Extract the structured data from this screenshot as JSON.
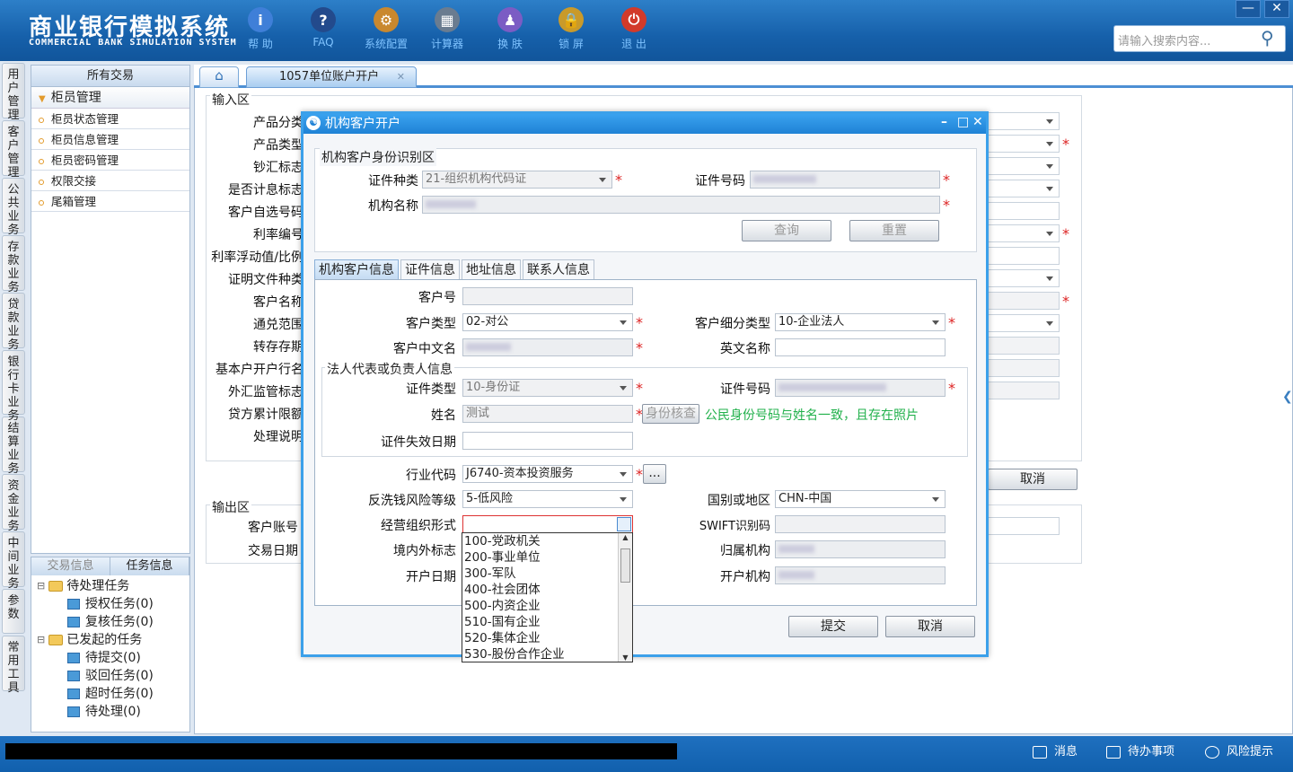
{
  "app": {
    "title_cn": "商业银行模拟系统",
    "title_en": "COMMERCIAL BANK SIMULATION SYSTEM"
  },
  "toolbar": [
    {
      "label": "帮 助",
      "icon": "info-icon",
      "glyph": "i",
      "color": "#3f7fd8"
    },
    {
      "label": "FAQ",
      "icon": "question-icon",
      "glyph": "?",
      "color": "#234a8c"
    },
    {
      "label": "系统配置",
      "icon": "toolbox-icon",
      "glyph": "⚙",
      "color": "#c9882e"
    },
    {
      "label": "计算器",
      "icon": "calculator-icon",
      "glyph": "▦",
      "color": "#6a7c90"
    },
    {
      "label": "换 肤",
      "icon": "shirt-icon",
      "glyph": "♟",
      "color": "#7b5cc4"
    },
    {
      "label": "锁 屏",
      "icon": "lock-icon",
      "glyph": "🔒",
      "color": "#c99a2a"
    },
    {
      "label": "退 出",
      "icon": "power-icon",
      "glyph": "⏻",
      "color": "#d23a2a"
    }
  ],
  "search": {
    "placeholder": "请输入搜索内容..."
  },
  "side_tabs": [
    "用户管理",
    "客户管理",
    "公共业务",
    "存款业务",
    "贷款业务",
    "银行卡业务",
    "结算业务",
    "资金业务",
    "中间业务",
    "参数",
    "常用工具"
  ],
  "nav": {
    "header": "所有交易",
    "group": "柜员管理",
    "items": [
      "柜员状态管理",
      "柜员信息管理",
      "柜员密码管理",
      "权限交接",
      "尾箱管理"
    ]
  },
  "tasks": {
    "tabs": [
      "交易信息",
      "任务信息"
    ],
    "pending_label": "待处理任务",
    "pending": [
      "授权任务(0)",
      "复核任务(0)"
    ],
    "initiated_label": "已发起的任务",
    "initiated": [
      "待提交(0)",
      "驳回任务(0)",
      "超时任务(0)",
      "待处理(0)"
    ]
  },
  "tabs": {
    "page": "1057单位账户开户"
  },
  "background": {
    "input_area": "输入区",
    "labels": [
      "产品分类",
      "产品类型",
      "钞汇标志",
      "是否计息标志",
      "客户自选号码",
      "利率编号",
      "利率浮动值/比例",
      "证明文件种类",
      "客户名称",
      "通兑范围",
      "转存存期",
      "基本户开户行名",
      "外汇监管标志",
      "贷方累计限额",
      "处理说明"
    ],
    "output_area": "输出区",
    "output_labels": [
      "客户账号",
      "交易日期"
    ],
    "cancel": "取消"
  },
  "dialog": {
    "title": "机构客户开户",
    "id_section": "机构客户身份识别区",
    "id_type_label": "证件种类",
    "id_type_value": "21-组织机构代码证",
    "id_no_label": "证件号码",
    "name_label": "机构名称",
    "query_btn": "查询",
    "reset_btn": "重置",
    "tabs": [
      "机构客户信息",
      "证件信息",
      "地址信息",
      "联系人信息"
    ],
    "cust_no_label": "客户号",
    "cust_type_label": "客户类型",
    "cust_type_value": "02-对公",
    "cust_sub_label": "客户细分类型",
    "cust_sub_value": "10-企业法人",
    "cn_name_label": "客户中文名",
    "en_name_label": "英文名称",
    "legal_section": "法人代表或负责人信息",
    "legal_id_type_label": "证件类型",
    "legal_id_type_value": "10-身份证",
    "legal_id_no_label": "证件号码",
    "legal_name_label": "姓名",
    "legal_name_value": "测试",
    "verify_btn": "身份核查",
    "verify_msg": "公民身份号码与姓名一致，且存在照片",
    "expire_label": "证件失效日期",
    "industry_label": "行业代码",
    "industry_value": "J6740-资本投资服务",
    "more_btn": "...",
    "aml_label": "反洗钱风险等级",
    "aml_value": "5-低风险",
    "country_label": "国别或地区",
    "country_value": "CHN-中国",
    "org_form_label": "经营组织形式",
    "swift_label": "SWIFT识别码",
    "domestic_label": "境内外标志",
    "belong_label": "归属机构",
    "open_date_label": "开户日期",
    "open_org_label": "开户机构",
    "submit_btn": "提交",
    "cancel_btn": "取消"
  },
  "dropdown": [
    "100-党政机关",
    "200-事业单位",
    "300-军队",
    "400-社会团体",
    "500-内资企业",
    "510-国有企业",
    "520-集体企业",
    "530-股份合作企业"
  ],
  "status": {
    "msg": "消息",
    "todo": "待办事项",
    "risk": "风险提示"
  }
}
